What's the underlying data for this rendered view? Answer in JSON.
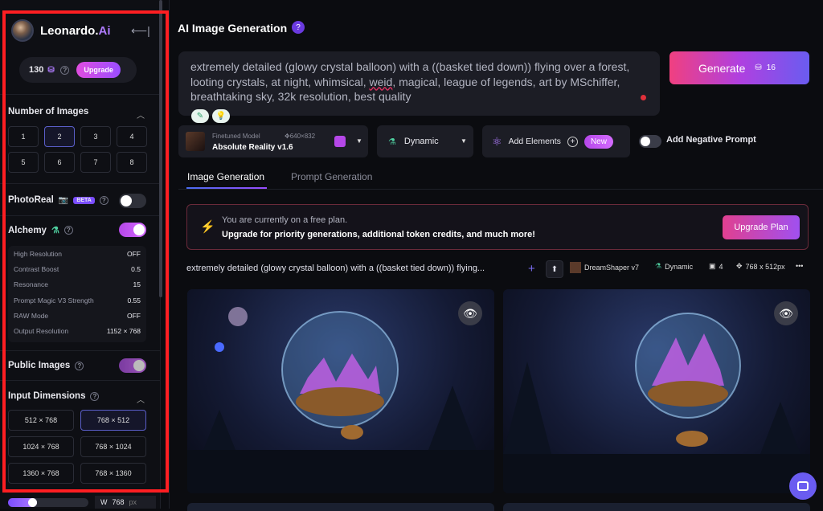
{
  "sidebar": {
    "logo": {
      "name": "Leonardo.",
      "suffix": "Ai"
    },
    "credits": {
      "count": "130",
      "upgrade": "Upgrade"
    },
    "num_images": {
      "title": "Number of Images",
      "options": [
        "1",
        "2",
        "3",
        "4",
        "5",
        "6",
        "7",
        "8"
      ],
      "selected": "2"
    },
    "photoreal": {
      "label": "PhotoReal",
      "badge": "BETA",
      "enabled": false
    },
    "alchemy": {
      "label": "Alchemy",
      "enabled": true,
      "settings": [
        {
          "label": "High Resolution",
          "value": "OFF"
        },
        {
          "label": "Contrast Boost",
          "value": "0.5"
        },
        {
          "label": "Resonance",
          "value": "15"
        },
        {
          "label": "Prompt Magic V3 Strength",
          "value": "0.55"
        },
        {
          "label": "RAW Mode",
          "value": "OFF"
        },
        {
          "label": "Output Resolution",
          "value": "1152 × 768"
        }
      ]
    },
    "public_images": {
      "label": "Public Images",
      "enabled": true
    },
    "input_dimensions": {
      "title": "Input Dimensions",
      "options": [
        "512 × 768",
        "768 × 512",
        "1024 × 768",
        "768 × 1024",
        "1360 × 768",
        "768 × 1360"
      ],
      "selected": "768 × 512"
    },
    "width": {
      "label": "W",
      "value": "768",
      "unit": "px",
      "slider_fraction": 0.25
    }
  },
  "header": {
    "title": "AI Image Generation",
    "help": "?"
  },
  "prompt": {
    "text_before": "extremely detailed (glowy crystal balloon) with a ((basket tied down)) flying over a forest, looting crystals, at night, whimsical, ",
    "misspelled": "weid",
    "text_after": ", magical, league of legends, art by MSchiffer, breathtaking sky, 32k resolution, best quality"
  },
  "generate": {
    "label": "Generate",
    "cost": "16"
  },
  "model": {
    "caption": "Finetuned Model",
    "dims": "640×832",
    "name": "Absolute Reality v1.6"
  },
  "style": {
    "label": "Dynamic"
  },
  "elements": {
    "label": "Add Elements",
    "badge": "New"
  },
  "negative_prompt": {
    "label": "Add Negative Prompt",
    "enabled": false
  },
  "tabs": [
    {
      "label": "Image Generation",
      "active": true
    },
    {
      "label": "Prompt Generation",
      "active": false
    }
  ],
  "banner": {
    "line1": "You are currently on a free plan.",
    "line2": "Upgrade for priority generations, additional token credits, and much more!",
    "button": "Upgrade Plan"
  },
  "generation_meta": {
    "prompt_short": "extremely detailed (glowy crystal balloon) with a ((basket tied down)) flying...",
    "model": "DreamShaper v7",
    "style": "Dynamic",
    "count": "4",
    "dims": "768 x 512px",
    "more": "•••"
  },
  "colors": {
    "accent": "#b547e8",
    "highlight": "#ff1e22",
    "generate_start": "#f04080",
    "generate_end": "#6a5cf0"
  }
}
